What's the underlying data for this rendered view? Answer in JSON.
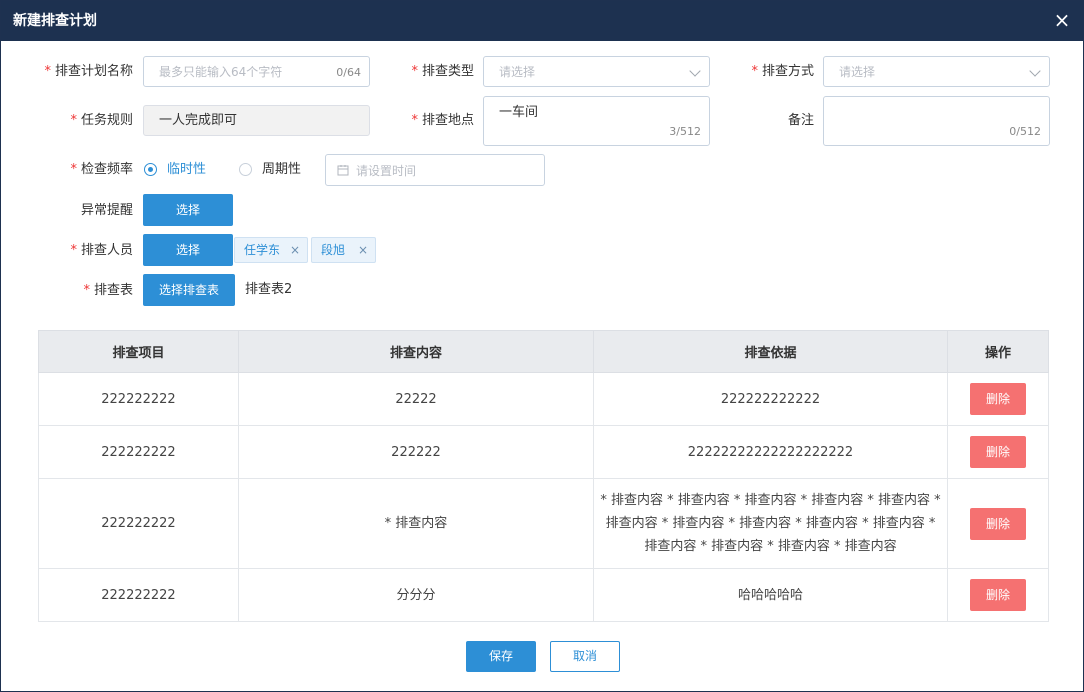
{
  "dialog": {
    "title": "新建排查计划",
    "close_symbol": "×"
  },
  "form": {
    "plan_name": {
      "label": "排查计划名称",
      "placeholder": "最多只能输入64个字符",
      "counter": "0/64"
    },
    "check_type": {
      "label": "排查类型",
      "placeholder": "请选择"
    },
    "check_method": {
      "label": "排查方式",
      "placeholder": "请选择"
    },
    "task_rule": {
      "label": "任务规则",
      "value": "一人完成即可"
    },
    "location": {
      "label": "排查地点",
      "value": "一车间",
      "counter": "3/512"
    },
    "remark": {
      "label": "备注",
      "counter": "0/512"
    },
    "frequency": {
      "label": "检查频率",
      "options": [
        {
          "label": "临时性",
          "selected": true
        },
        {
          "label": "周期性",
          "selected": false
        }
      ],
      "time_placeholder": "请设置时间"
    },
    "alert": {
      "label": "异常提醒",
      "button": "选择"
    },
    "inspectors": {
      "label": "排查人员",
      "button": "选择",
      "tags": [
        "任学东",
        "段旭"
      ],
      "tag_close": "×"
    },
    "check_table": {
      "label": "排查表",
      "button": "选择排查表",
      "value": "排查表2"
    }
  },
  "table": {
    "headers": [
      "排查项目",
      "排查内容",
      "排查依据",
      "操作"
    ],
    "rows": [
      {
        "item": "222222222",
        "content": "22222",
        "basis": "222222222222",
        "action": "删除"
      },
      {
        "item": "222222222",
        "content": "222222",
        "basis": "22222222222222222222",
        "action": "删除"
      },
      {
        "item": "222222222",
        "content": "* 排查内容",
        "basis": "* 排查内容 * 排查内容 * 排查内容 * 排查内容 * 排查内容 * 排查内容 * 排查内容 * 排查内容 * 排查内容 * 排查内容 * 排查内容 * 排查内容 * 排查内容 * 排查内容",
        "action": "删除"
      },
      {
        "item": "222222222",
        "content": "分分分",
        "basis": "哈哈哈哈哈",
        "action": "删除"
      }
    ]
  },
  "footer": {
    "save": "保存",
    "cancel": "取消"
  },
  "colors": {
    "header": "#1d3150",
    "primary": "#2d8fd6",
    "danger": "#f57171",
    "required": "#e33333"
  }
}
